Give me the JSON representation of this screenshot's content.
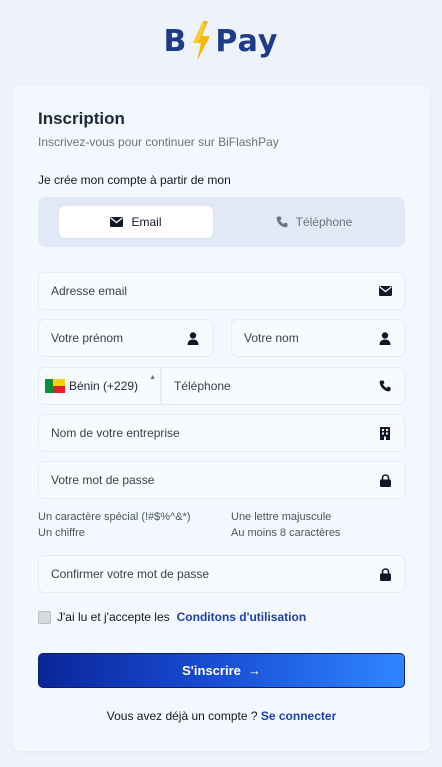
{
  "brand": {
    "logo_left": "B",
    "logo_right": "Pay"
  },
  "header": {
    "title": "Inscription",
    "subtitle": "Inscrivez-vous pour continuer sur BiFlashPay",
    "choose_label": "Je crée mon compte à partir de mon"
  },
  "tabs": [
    {
      "label": "Email",
      "icon": "envelope-icon",
      "active": true
    },
    {
      "label": "Téléphone",
      "icon": "phone-icon",
      "active": false
    }
  ],
  "form": {
    "email": {
      "placeholder": "Adresse email",
      "icon": "envelope-icon"
    },
    "first_name": {
      "placeholder": "Votre prénom",
      "icon": "user-icon"
    },
    "last_name": {
      "placeholder": "Votre nom",
      "icon": "user-icon"
    },
    "country": {
      "value": "Bénin (+229)",
      "flag": "benin-flag"
    },
    "phone": {
      "placeholder": "Téléphone",
      "icon": "phone-icon"
    },
    "company": {
      "placeholder": "Nom de votre entreprise",
      "icon": "building-icon"
    },
    "password": {
      "placeholder": "Votre mot de passe",
      "icon": "lock-icon"
    },
    "password_hints": [
      "Un caractère spécial (!#$%^&*)",
      "Un chiffre",
      "Une lettre majuscule",
      "Au moins 8 caractères"
    ],
    "confirm_password": {
      "placeholder": "Confirmer votre mot de passe",
      "icon": "lock-icon"
    },
    "terms_text": "J'ai lu et j'accepte les",
    "terms_link": "Conditons d'utilisation",
    "terms_checked": false,
    "submit_label": "S'inscrire",
    "submit_arrow": "→"
  },
  "footer": {
    "login_prompt": "Vous avez déjà un compte ?",
    "login_link": "Se connecter"
  },
  "colors": {
    "brand_navy": "#1e3a8a",
    "brand_yellow": "#f5b800",
    "link": "#1e40af",
    "button_start": "#0a2699",
    "button_end": "#2f86ff"
  }
}
